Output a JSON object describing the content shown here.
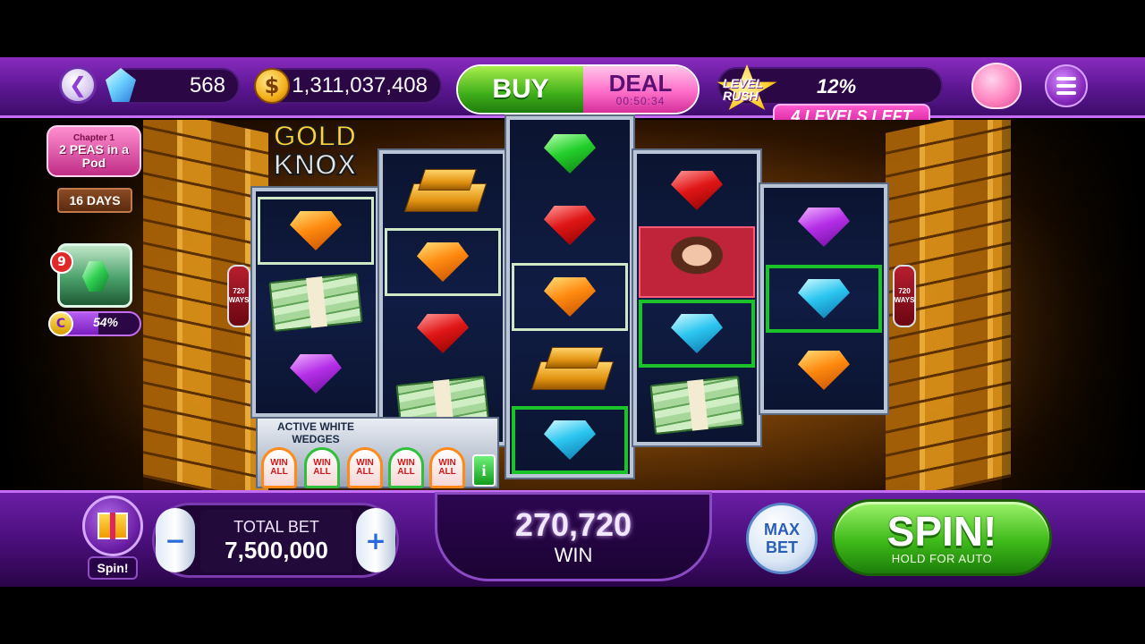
{
  "topbar": {
    "gems": "568",
    "coins": "1,311,037,408",
    "buy_label": "BUY",
    "deal_label": "DEAL",
    "deal_timer": "00:50:34",
    "level_rush_label": "LEVEL RUSH",
    "level_rush_progress": "12%",
    "levels_left": "4 LEVELS LEFT"
  },
  "sidebar": {
    "event_chapter": "Chapter 1",
    "event_title": "2 PEAS in a Pod",
    "event_days": "16 DAYS",
    "chest_count": "9",
    "chest_progress": "54%",
    "chest_progress_value": 0.54
  },
  "game": {
    "logo_line1": "GOLD",
    "logo_line2": "KNOX",
    "ways_label_left": "720 WAYS",
    "ways_label_right": "720 WAYS",
    "wedges_label": "ACTIVE WHITE WEDGES",
    "wedge_text": "WIN ALL",
    "info_icon": "i",
    "reels": [
      [
        "orange-gem",
        "cash",
        "purple-gem"
      ],
      [
        "gold-bars",
        "orange-gem",
        "red-gem",
        "cash"
      ],
      [
        "green-gem",
        "red-gem",
        "orange-gem",
        "gold-bars",
        "blue-gem"
      ],
      [
        "red-gem",
        "woman",
        "blue-gem",
        "cash"
      ],
      [
        "purple-gem",
        "blue-gem",
        "orange-gem"
      ]
    ]
  },
  "bottombar": {
    "gift_label": "Spin!",
    "bet_title": "TOTAL BET",
    "bet_value": "7,500,000",
    "minus_label": "−",
    "plus_label": "+",
    "win_value": "270,720",
    "win_label": "WIN",
    "maxbet_line1": "MAX",
    "maxbet_line2": "BET",
    "spin_label": "SPIN!",
    "spin_sub": "HOLD FOR AUTO"
  },
  "colors": {
    "accent_purple": "#8a2bc0",
    "spin_green": "#3fba1a",
    "win_green_outline": "#1bc22a"
  }
}
